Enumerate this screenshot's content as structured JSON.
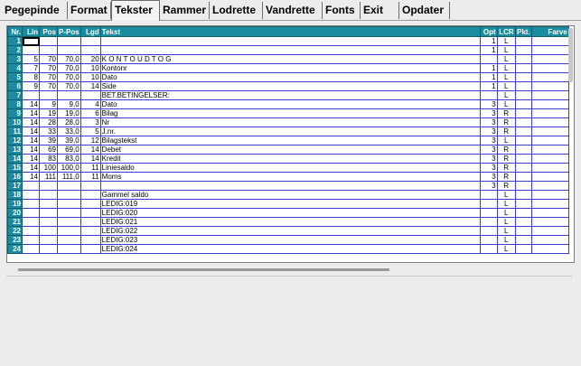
{
  "tabs": [
    {
      "label": "Pegepinde",
      "active": false
    },
    {
      "label": "Format",
      "active": false
    },
    {
      "label": "Tekster",
      "active": true
    },
    {
      "label": "Rammer",
      "active": false
    },
    {
      "label": "Lodrette",
      "active": false
    },
    {
      "label": "Vandrette",
      "active": false
    },
    {
      "label": "Fonts",
      "active": false
    },
    {
      "label": "Exit",
      "active": false
    },
    {
      "label": "Opdater",
      "active": false
    }
  ],
  "table": {
    "headers": [
      "Nr.",
      "Lin",
      "Pos",
      "P-Pos",
      "Lgd",
      "Tekst",
      "Opt",
      "LCR",
      "Pkt.",
      "Farve"
    ],
    "rows": [
      [
        "1",
        "",
        "",
        "",
        "",
        "",
        "1",
        "L",
        "",
        ""
      ],
      [
        "2",
        "",
        "",
        "",
        "",
        "",
        "1",
        "L",
        "",
        ""
      ],
      [
        "3",
        "5",
        "70",
        "70,0",
        "20",
        "K O N T O U D T O G",
        "",
        "L",
        "",
        ""
      ],
      [
        "4",
        "7",
        "70",
        "70,0",
        "10",
        "Kontonr",
        "1",
        "L",
        "",
        ""
      ],
      [
        "5",
        "8",
        "70",
        "70,0",
        "10",
        "Dato",
        "1",
        "L",
        "",
        ""
      ],
      [
        "6",
        "9",
        "70",
        "70,0",
        "14",
        "Side",
        "1",
        "L",
        "",
        ""
      ],
      [
        "7",
        "",
        "",
        "",
        "",
        "BET.BETINGELSER:",
        "",
        "L",
        "",
        ""
      ],
      [
        "8",
        "14",
        "9",
        "9,0",
        "4",
        "Dato",
        "3",
        "L",
        "",
        ""
      ],
      [
        "9",
        "14",
        "19",
        "19,0",
        "6",
        "Bilag",
        "3",
        "R",
        "",
        ""
      ],
      [
        "10",
        "14",
        "28",
        "28,0",
        "3",
        "Nr",
        "3",
        "R",
        "",
        ""
      ],
      [
        "11",
        "14",
        "33",
        "33,0",
        "5",
        "J.nr.",
        "3",
        "R",
        "",
        ""
      ],
      [
        "12",
        "14",
        "39",
        "39,0",
        "12",
        "Bilagstekst",
        "3",
        "L",
        "",
        ""
      ],
      [
        "13",
        "14",
        "69",
        "69,0",
        "14",
        "Debet",
        "3",
        "R",
        "",
        ""
      ],
      [
        "14",
        "14",
        "83",
        "83,0",
        "14",
        "Kredit",
        "3",
        "R",
        "",
        ""
      ],
      [
        "15",
        "14",
        "100",
        "100,0",
        "11",
        "Liniesaldo",
        "3",
        "R",
        "",
        ""
      ],
      [
        "16",
        "14",
        "111",
        "111,0",
        "11",
        "Moms",
        "3",
        "R",
        "",
        ""
      ],
      [
        "17",
        "",
        "",
        "",
        "",
        "",
        "3",
        "R",
        "",
        ""
      ],
      [
        "18",
        "",
        "",
        "",
        "",
        "Gammel saldo",
        "",
        "L",
        "",
        ""
      ],
      [
        "19",
        "",
        "",
        "",
        "",
        "LEDIG:019",
        "",
        "L",
        "",
        ""
      ],
      [
        "20",
        "",
        "",
        "",
        "",
        "LEDIG:020",
        "",
        "L",
        "",
        ""
      ],
      [
        "21",
        "",
        "",
        "",
        "",
        "LEDIG:021",
        "",
        "L",
        "",
        ""
      ],
      [
        "22",
        "",
        "",
        "",
        "",
        "LEDIG:022",
        "",
        "L",
        "",
        ""
      ],
      [
        "23",
        "",
        "",
        "",
        "",
        "LEDIG:023",
        "",
        "L",
        "",
        ""
      ],
      [
        "24",
        "",
        "",
        "",
        "",
        "LEDIG:024",
        "",
        "L",
        "",
        ""
      ]
    ]
  },
  "colors": {
    "header_bg": "#1b8ba0",
    "grid_line": "#3b3bd0",
    "tab_bar_bg": "#ececec"
  }
}
